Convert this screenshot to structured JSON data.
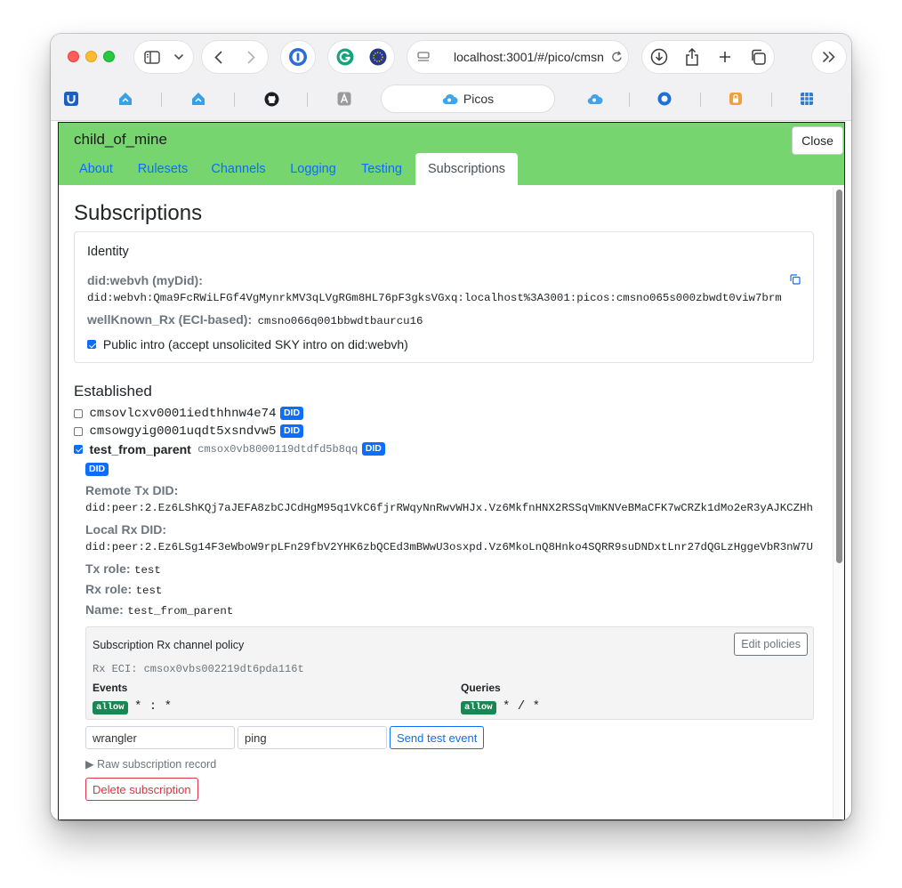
{
  "browser": {
    "url": "localhost:3001/#/pico/cmsn",
    "active_tab_label": "Picos"
  },
  "pico": {
    "name": "child_of_mine",
    "close_label": "Close",
    "tabs": [
      "About",
      "Rulesets",
      "Channels",
      "Logging",
      "Testing",
      "Subscriptions"
    ],
    "active_tab": "Subscriptions"
  },
  "subscriptions": {
    "title": "Subscriptions",
    "identity": {
      "title": "Identity",
      "did_label": "did:webvh (myDid):",
      "did_value": "did:webvh:Qma9FcRWiLFGf4VgMynrkMV3qLVgRGm8HL76pF3gksVGxq:localhost%3A3001:picos:cmsno065s000zbwdt0viw7brm",
      "wellknown_label": "wellKnown_Rx (ECI-based):",
      "wellknown_value": "cmsno066q001bbwdtbaurcu16",
      "public_intro_label": "Public intro (accept unsolicited SKY intro on did:webvh)",
      "public_intro_checked": true
    },
    "established_title": "Established",
    "items": [
      {
        "id": "cmsovlcxv0001iedthhnw4e74",
        "badge": "DID",
        "checked": false
      },
      {
        "id": "cmsowgyig0001uqdt5xsndvw5",
        "badge": "DID",
        "checked": false
      },
      {
        "name": "test_from_parent",
        "id": "cmsox0vb8000119dtdfd5b8qq",
        "badge": "DID",
        "checked": true
      }
    ],
    "detail": {
      "badge": "DID",
      "remote_tx_label": "Remote Tx DID:",
      "remote_tx_value": "did:peer:2.Ez6LShKQj7aJEFA8zbCJCdHgM95q1VkC6fjrRWqyNnRwvWHJx.Vz6MkfnHNX2RSSqVmKNVeBMaCFK7wCRZk1dMo2eR3yAJKCZHh",
      "local_rx_label": "Local Rx DID:",
      "local_rx_value": "did:peer:2.Ez6LSg14F3eWboW9rpLFn29fbV2YHK6zbQCEd3mBWwU3osxpd.Vz6MkoLnQ8Hnko4SQRR9suDNDxtLnr27dQGLzHggeVbR3nW7U",
      "tx_role_label": "Tx role:",
      "tx_role_value": "test",
      "rx_role_label": "Rx role:",
      "rx_role_value": "test",
      "name_label": "Name:",
      "name_value": "test_from_parent"
    },
    "policy": {
      "title": "Subscription Rx channel policy",
      "edit_label": "Edit policies",
      "rx_eci": "Rx ECI: cmsox0vbs002219dt6pda116t",
      "events_label": "Events",
      "events_badge": "allow",
      "events_rule": "* : *",
      "queries_label": "Queries",
      "queries_badge": "allow",
      "queries_rule": "* / *"
    },
    "test_event": {
      "domain_value": "wrangler",
      "type_value": "ping",
      "send_label": "Send test event"
    },
    "raw_record_label": "▶ Raw subscription record",
    "delete_label": "Delete subscription"
  },
  "colors": {
    "header_green": "#76d56e",
    "link_blue": "#0d6efd",
    "allow_green": "#198754",
    "danger_red": "#dc3545"
  }
}
